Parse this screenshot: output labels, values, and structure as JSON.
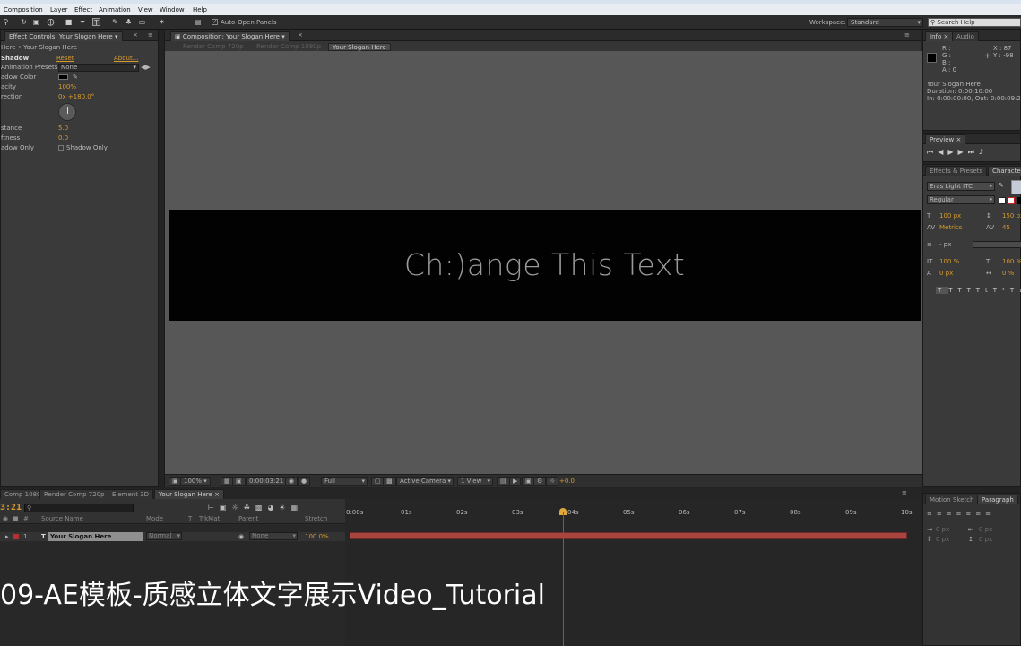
{
  "menu": {
    "items": [
      "Composition",
      "Layer",
      "Effect",
      "Animation",
      "View",
      "Window",
      "Help"
    ]
  },
  "toolbar": {
    "auto_open_label": "Auto-Open Panels",
    "workspace_label": "Workspace:",
    "workspace_value": "Standard",
    "search_placeholder": "Search Help"
  },
  "effect_controls": {
    "tab_label": "Effect Controls: Your Slogan Here",
    "breadcrumb": "Here • Your Slogan Here",
    "effect_name": "Shadow",
    "reset_label": "Reset",
    "about_label": "About...",
    "animation_presets_label": "Animation Presets:",
    "animation_presets_value": "None",
    "shadow_color_label": "adow Color",
    "opacity_label": "acity",
    "opacity_value": "100%",
    "direction_label": "rection",
    "direction_value": "0x +180.0°",
    "distance_label": "stance",
    "distance_value": "5.0",
    "softness_label": "ftness",
    "softness_value": "0.0",
    "shadow_only_label": "adow Only",
    "shadow_only_checkbox": "Shadow Only"
  },
  "composition": {
    "tab_label": "Composition: Your Slogan Here",
    "subtabs": [
      "Render Comp 720p",
      "Render Comp 1080p",
      "Your Slogan Here"
    ],
    "text": "Ch:)ange This Text",
    "zoom": "100%",
    "timecode": "0:00:03:21",
    "resolution": "Full",
    "camera": "Active Camera",
    "view": "1 View",
    "exposure": "+0.0"
  },
  "info": {
    "tabs": [
      "Info",
      "Audio"
    ],
    "r_label": "R :",
    "g_label": "G :",
    "b_label": "B :",
    "a_label": "A : 0",
    "x_label": "X : 87",
    "y_label": "Y : -98",
    "layer_name": "Your Slogan Here",
    "duration": "Duration: 0:00:10:00",
    "in_out": "In: 0:00:00:00, Out: 0:00:09:24"
  },
  "preview": {
    "tab_label": "Preview"
  },
  "character": {
    "tabs": [
      "Effects & Presets",
      "Characte"
    ],
    "font_name": "Eras Light ITC",
    "font_style": "Regular",
    "font_size": "100 px",
    "leading": "150 px",
    "kerning": "Metrics",
    "tracking": "45",
    "stroke": "- px",
    "vscale": "100 %",
    "hscale": "100 %",
    "baseline": "0 px",
    "tsume": "0 %"
  },
  "paragraph": {
    "tabs": [
      "Motion Sketch",
      "Paragraph"
    ],
    "indent_left": "0 px",
    "indent_right": "0 px",
    "space_before": "0 px",
    "space_after": "0 px"
  },
  "timeline": {
    "tabs": [
      "Comp 1080p",
      "Render Comp 720p",
      "Element 3D",
      "Your Slogan Here"
    ],
    "timecode": "3:21",
    "columns": {
      "source_name": "Source Name",
      "mode": "Mode",
      "t": "T",
      "trkmat": "TrkMat",
      "parent": "Parent",
      "stretch": "Stretch"
    },
    "layer": {
      "index": "1",
      "name": "Your Slogan Here",
      "mode": "Normal",
      "parent": "None",
      "stretch": "100.0%"
    },
    "ruler": [
      "0:00s",
      "01s",
      "02s",
      "03s",
      "04s",
      "05s",
      "06s",
      "07s",
      "08s",
      "09s",
      "10s"
    ]
  },
  "caption": "09-AE模板-质感立体文字展示Video_Tutorial",
  "colors": {
    "accent_orange": "#d79b2d",
    "layer_bar": "#a9453f",
    "cti": "#c23b2f"
  }
}
